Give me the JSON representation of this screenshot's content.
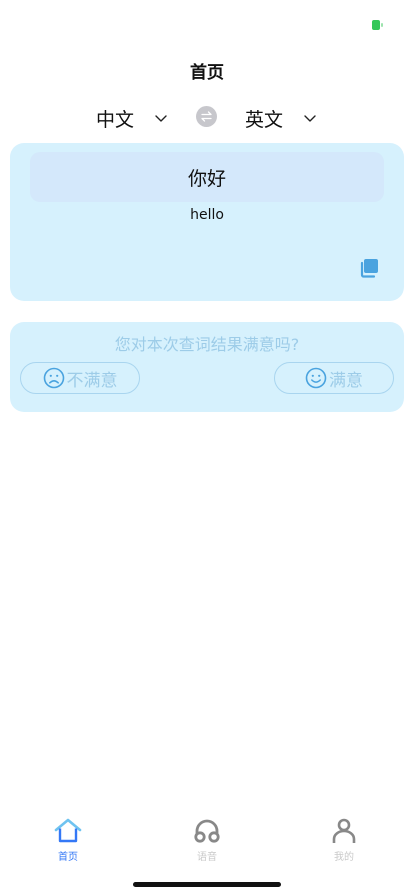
{
  "nav": {
    "title": "首页"
  },
  "languages": {
    "source": "中文",
    "target": "英文"
  },
  "result": {
    "source_text": "你好",
    "translated_text": "hello"
  },
  "feedback": {
    "question": "您对本次查词结果满意吗?",
    "unsatisfied_label": "不满意",
    "satisfied_label": "满意"
  },
  "tabs": [
    {
      "label": "首页",
      "icon": "home-icon",
      "active": true
    },
    {
      "label": "语音",
      "icon": "headphones-icon",
      "active": false
    },
    {
      "label": "我的",
      "icon": "person-icon",
      "active": false
    }
  ],
  "colors": {
    "card_bg": "#d6f1fd",
    "source_box_bg": "#d4e8fb",
    "accent": "#3478f6",
    "feedback_text": "#9dcce8",
    "copy_icon": "#4aa3df",
    "battery": "#34c759"
  }
}
